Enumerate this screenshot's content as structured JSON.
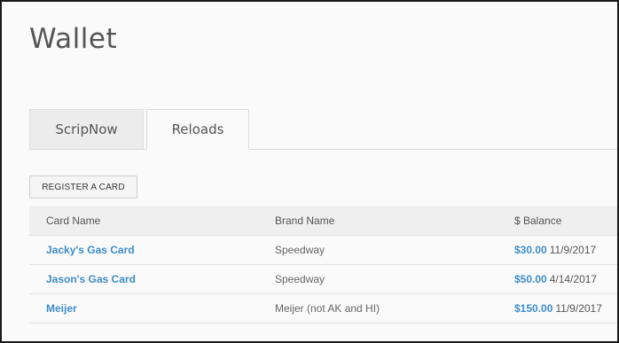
{
  "page": {
    "title": "Wallet"
  },
  "tabs": [
    {
      "label": "ScripNow",
      "active": false
    },
    {
      "label": "Reloads",
      "active": true
    }
  ],
  "actions": {
    "register_label": "REGISTER A CARD"
  },
  "table": {
    "headers": {
      "card_name": "Card Name",
      "brand_name": "Brand Name",
      "balance": "$ Balance"
    },
    "rows": [
      {
        "card_name": "Jacky's Gas Card",
        "brand": "Speedway",
        "balance": "$30.00",
        "date": "11/9/2017"
      },
      {
        "card_name": "Jason's Gas Card",
        "brand": "Speedway",
        "balance": "$50.00",
        "date": "4/14/2017"
      },
      {
        "card_name": "Meijer",
        "brand": "Meijer (not AK and HI)",
        "balance": "$150.00",
        "date": "11/9/2017"
      }
    ]
  },
  "colors": {
    "link": "#3d8dc8",
    "title": "#555555",
    "header_bg": "#efefef"
  }
}
